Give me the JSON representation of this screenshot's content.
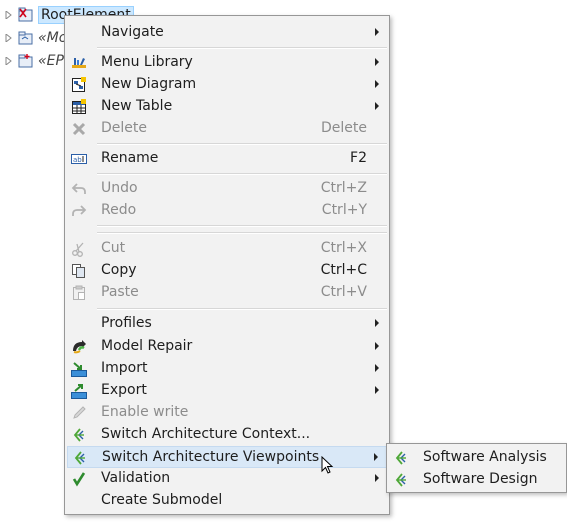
{
  "tree": {
    "items": [
      {
        "label": "RootElement",
        "italic": false
      },
      {
        "label": "«Mo",
        "italic": true
      },
      {
        "label": "«EP",
        "italic": true
      }
    ]
  },
  "menu": {
    "items": [
      {
        "label": "Navigate",
        "shortcut": "",
        "submenu": true,
        "disabled": false
      },
      {
        "label": "Menu Library",
        "shortcut": "",
        "submenu": true,
        "disabled": false
      },
      {
        "label": "New Diagram",
        "shortcut": "",
        "submenu": true,
        "disabled": false
      },
      {
        "label": "New Table",
        "shortcut": "",
        "submenu": true,
        "disabled": false
      },
      {
        "label": "Delete",
        "shortcut": "Delete",
        "submenu": false,
        "disabled": true
      },
      {
        "label": "Rename",
        "shortcut": "F2",
        "submenu": false,
        "disabled": false
      },
      {
        "label": "Undo",
        "shortcut": "Ctrl+Z",
        "submenu": false,
        "disabled": true
      },
      {
        "label": "Redo",
        "shortcut": "Ctrl+Y",
        "submenu": false,
        "disabled": true
      },
      {
        "label": "Cut",
        "shortcut": "Ctrl+X",
        "submenu": false,
        "disabled": true
      },
      {
        "label": "Copy",
        "shortcut": "Ctrl+C",
        "submenu": false,
        "disabled": false
      },
      {
        "label": "Paste",
        "shortcut": "Ctrl+V",
        "submenu": false,
        "disabled": true
      },
      {
        "label": "Profiles",
        "shortcut": "",
        "submenu": true,
        "disabled": false
      },
      {
        "label": "Model Repair",
        "shortcut": "",
        "submenu": true,
        "disabled": false
      },
      {
        "label": "Import",
        "shortcut": "",
        "submenu": true,
        "disabled": false
      },
      {
        "label": "Export",
        "shortcut": "",
        "submenu": true,
        "disabled": false
      },
      {
        "label": "Enable write",
        "shortcut": "",
        "submenu": false,
        "disabled": true
      },
      {
        "label": "Switch Architecture Context...",
        "shortcut": "",
        "submenu": false,
        "disabled": false
      },
      {
        "label": "Switch Architecture Viewpoints",
        "shortcut": "",
        "submenu": true,
        "disabled": false,
        "highlighted": true
      },
      {
        "label": "Validation",
        "shortcut": "",
        "submenu": true,
        "disabled": false
      },
      {
        "label": "Create Submodel",
        "shortcut": "",
        "submenu": false,
        "disabled": false
      }
    ]
  },
  "submenu": {
    "items": [
      {
        "label": "Software Analysis"
      },
      {
        "label": "Software Design"
      }
    ]
  },
  "colors": {
    "menu_bg": "#f2f2f2",
    "highlight": "#d9e8f7",
    "disabled_text": "#8c8c8c",
    "selection": "#cce8ff"
  }
}
